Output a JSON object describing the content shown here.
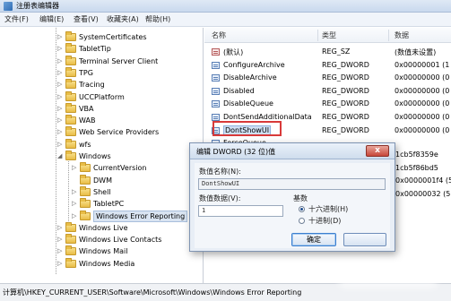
{
  "window": {
    "title": "注册表编辑器"
  },
  "menu": [
    "文件(F)",
    "编辑(E)",
    "查看(V)",
    "收藏夹(A)",
    "帮助(H)"
  ],
  "tree": {
    "nodes": [
      {
        "label": "SystemCertificates",
        "level": 1,
        "expand": "▷"
      },
      {
        "label": "TabletTip",
        "level": 1,
        "expand": "▷"
      },
      {
        "label": "Terminal Server Client",
        "level": 1,
        "expand": "▷"
      },
      {
        "label": "TPG",
        "level": 1,
        "expand": "▷"
      },
      {
        "label": "Tracing",
        "level": 1,
        "expand": "▷"
      },
      {
        "label": "UCCPlatform",
        "level": 1,
        "expand": "▷"
      },
      {
        "label": "VBA",
        "level": 1,
        "expand": "▷"
      },
      {
        "label": "WAB",
        "level": 1,
        "expand": "▷"
      },
      {
        "label": "Web Service Providers",
        "level": 1,
        "expand": "▷"
      },
      {
        "label": "wfs",
        "level": 1,
        "expand": "▷"
      },
      {
        "label": "Windows",
        "level": 1,
        "expand": "◢"
      },
      {
        "label": "CurrentVersion",
        "level": 2,
        "expand": "▷"
      },
      {
        "label": "DWM",
        "level": 2,
        "expand": ""
      },
      {
        "label": "Shell",
        "level": 2,
        "expand": "▷"
      },
      {
        "label": "TabletPC",
        "level": 2,
        "expand": "▷"
      },
      {
        "label": "Windows Error Reporting",
        "level": 2,
        "expand": "▷",
        "selected": true
      },
      {
        "label": "Windows Live",
        "level": 1,
        "expand": "▷"
      },
      {
        "label": "Windows Live Contacts",
        "level": 1,
        "expand": "▷"
      },
      {
        "label": "Windows Mail",
        "level": 1,
        "expand": "▷"
      },
      {
        "label": "Windows Media",
        "level": 1,
        "expand": "▷"
      }
    ]
  },
  "list": {
    "headers": {
      "name": "名称",
      "type": "类型",
      "data": "数据"
    },
    "rows": [
      {
        "name": "(默认)",
        "type": "REG_SZ",
        "data": "(数值未设置)",
        "kind": "sz"
      },
      {
        "name": "ConfigureArchive",
        "type": "REG_DWORD",
        "data": "0x00000001 (1",
        "kind": "dw"
      },
      {
        "name": "DisableArchive",
        "type": "REG_DWORD",
        "data": "0x00000000 (0",
        "kind": "dw"
      },
      {
        "name": "Disabled",
        "type": "REG_DWORD",
        "data": "0x00000000 (0",
        "kind": "dw"
      },
      {
        "name": "DisableQueue",
        "type": "REG_DWORD",
        "data": "0x00000000 (0",
        "kind": "dw"
      },
      {
        "name": "DontSendAdditionalData",
        "type": "REG_DWORD",
        "data": "0x00000000 (0",
        "kind": "dw"
      },
      {
        "name": "DontShowUI",
        "type": "REG_DWORD",
        "data": "0x00000000 (0",
        "kind": "dw",
        "highlight": true
      },
      {
        "name": "ForceQueue",
        "type": "",
        "data": "",
        "kind": "dw"
      }
    ],
    "partial_right": [
      "1cb5f8359e",
      "1cb5f86bd5",
      "0x0000001f4 (5",
      "0x00000032 (5"
    ]
  },
  "status": {
    "path": "计算机\\HKEY_CURRENT_USER\\Software\\Microsoft\\Windows\\Windows Error Reporting"
  },
  "dialog": {
    "title": "编辑 DWORD (32 位)值",
    "close": "x",
    "name_label": "数值名称(N):",
    "name_value": "DontShowUI",
    "data_label": "数值数据(V):",
    "data_value": "1",
    "base_label": "基数",
    "radios": [
      {
        "label": "十六进制(H)",
        "checked": true
      },
      {
        "label": "十进制(D)",
        "checked": false
      }
    ],
    "ok": "确定",
    "cancel": ""
  }
}
